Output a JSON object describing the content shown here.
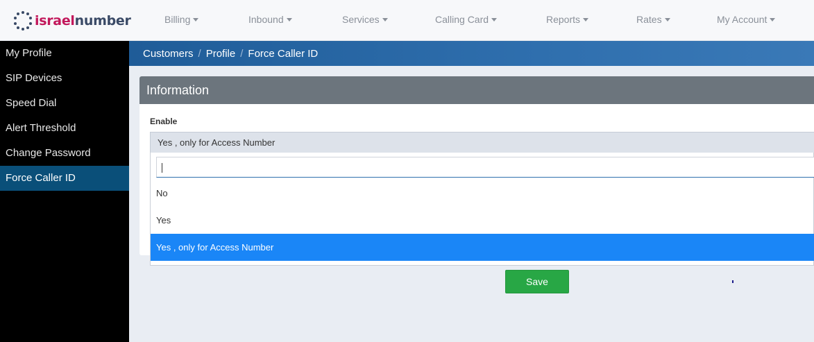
{
  "brand": {
    "part1": "israel",
    "part2": "number"
  },
  "nav": [
    {
      "label": "Billing"
    },
    {
      "label": "Inbound"
    },
    {
      "label": "Services"
    },
    {
      "label": "Calling Card"
    },
    {
      "label": "Reports"
    },
    {
      "label": "Rates"
    },
    {
      "label": "My Account"
    }
  ],
  "sidebar": {
    "items": [
      {
        "label": "My Profile"
      },
      {
        "label": "SIP Devices"
      },
      {
        "label": "Speed Dial"
      },
      {
        "label": "Alert Threshold"
      },
      {
        "label": "Change Password"
      },
      {
        "label": "Force Caller ID"
      }
    ],
    "active": "Force Caller ID"
  },
  "breadcrumb": [
    "Customers",
    "Profile",
    "Force Caller ID"
  ],
  "panel": {
    "title": "Information",
    "field_label": "Enable",
    "selected_value": "Yes , only for Access Number"
  },
  "dropdown": {
    "search_value": "",
    "options": [
      "No",
      "Yes",
      "Yes , only for Access Number"
    ],
    "selected": "Yes , only for Access Number"
  },
  "actions": {
    "save_label": "Save"
  },
  "colors": {
    "brand_pink": "#c2185b",
    "brand_navy": "#3a4a66",
    "sidebar_active": "#0a4f79",
    "option_selected": "#1a86f7",
    "save_green": "#28a745"
  }
}
